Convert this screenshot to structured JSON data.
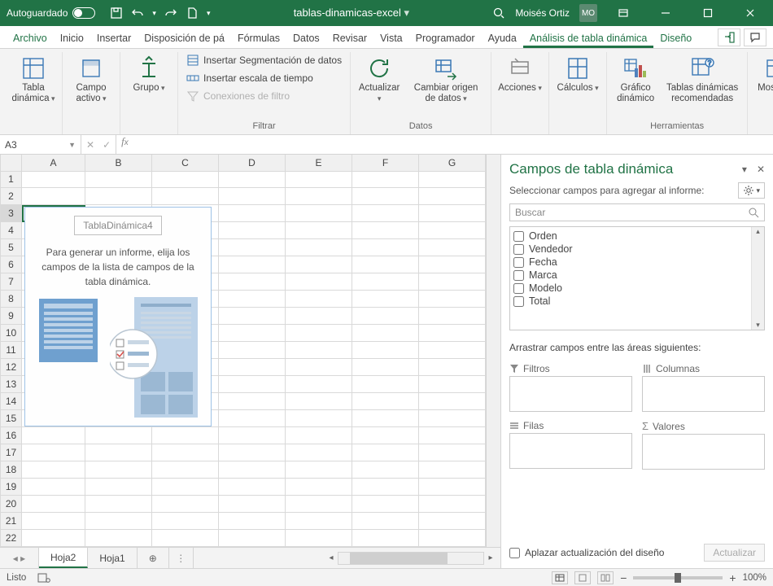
{
  "titlebar": {
    "autosave": "Autoguardado",
    "filename": "tablas-dinamicas-excel",
    "user_name": "Moisés Ortiz",
    "user_initials": "MO"
  },
  "ribbon_tabs": {
    "file": "Archivo",
    "items": [
      "Inicio",
      "Insertar",
      "Disposición de pá",
      "Fórmulas",
      "Datos",
      "Revisar",
      "Vista",
      "Programador",
      "Ayuda"
    ],
    "context": [
      "Análisis de tabla dinámica",
      "Diseño"
    ],
    "active": "Análisis de tabla dinámica"
  },
  "ribbon": {
    "pivottable": {
      "label": "Tabla dinámica"
    },
    "activefield": {
      "label": "Campo activo"
    },
    "group": {
      "label": "Grupo"
    },
    "filter": {
      "group_label": "Filtrar",
      "insert_slicer": "Insertar Segmentación de datos",
      "insert_timeline": "Insertar escala de tiempo",
      "filter_connections": "Conexiones de filtro"
    },
    "data": {
      "group_label": "Datos",
      "refresh": "Actualizar",
      "change_source": "Cambiar origen de datos"
    },
    "actions": {
      "label": "Acciones"
    },
    "calcs": {
      "label": "Cálculos"
    },
    "tools": {
      "group_label": "Herramientas",
      "pivot_chart": "Gráfico dinámico",
      "recommended": "Tablas dinámicas recomendadas"
    },
    "show": {
      "label": "Mostrar"
    }
  },
  "namebox": "A3",
  "columns": [
    "A",
    "B",
    "C",
    "D",
    "E",
    "F",
    "G"
  ],
  "rows": 22,
  "selected_cell": {
    "row": 3,
    "col": "A"
  },
  "pivot_placeholder": {
    "name": "TablaDinámica4",
    "hint": "Para generar un informe, elija los campos de la lista de campos de la tabla dinámica."
  },
  "taskpane": {
    "title": "Campos de tabla dinámica",
    "subtitle": "Seleccionar campos para agregar al informe:",
    "search_placeholder": "Buscar",
    "fields": [
      "Orden",
      "Vendedor",
      "Fecha",
      "Marca",
      "Modelo",
      "Total"
    ],
    "drag_hint": "Arrastrar campos entre las áreas siguientes:",
    "area_filters": "Filtros",
    "area_columns": "Columnas",
    "area_rows": "Filas",
    "area_values": "Valores",
    "defer": "Aplazar actualización del diseño",
    "update_btn": "Actualizar"
  },
  "sheets": {
    "tabs": [
      "Hoja2",
      "Hoja1"
    ],
    "active": "Hoja2"
  },
  "statusbar": {
    "ready": "Listo",
    "zoom": "100%"
  }
}
